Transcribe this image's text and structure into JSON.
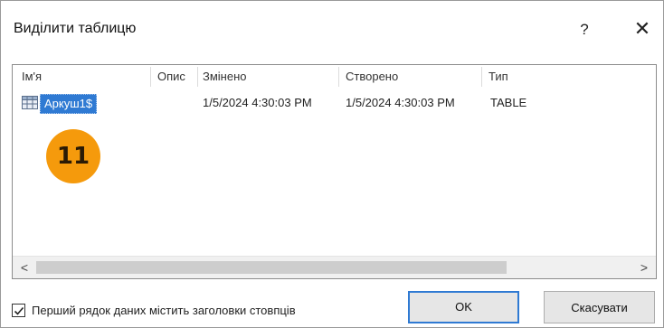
{
  "dialog": {
    "title": "Виділити таблицю",
    "help_label": "?",
    "close_label": "✕"
  },
  "list": {
    "columns": [
      "Ім'я",
      "Опис",
      "Змінено",
      "Створено",
      "Тип"
    ],
    "rows": [
      {
        "name": "Аркуш1$",
        "description": "",
        "modified": "1/5/2024 4:30:03 PM",
        "created": "1/5/2024 4:30:03 PM",
        "type": "TABLE"
      }
    ]
  },
  "badge": {
    "label": "11",
    "color": "#f59a0c"
  },
  "scrollbar": {
    "left_arrow": "<",
    "right_arrow": ">"
  },
  "footer": {
    "first_row_headers_label": "Перший рядок даних містить заголовки стовпців",
    "first_row_headers_checked": true,
    "ok_label": "OK",
    "cancel_label": "Скасувати"
  },
  "colors": {
    "selection": "#2f7ad3",
    "accent_border": "#2f7ad3"
  }
}
